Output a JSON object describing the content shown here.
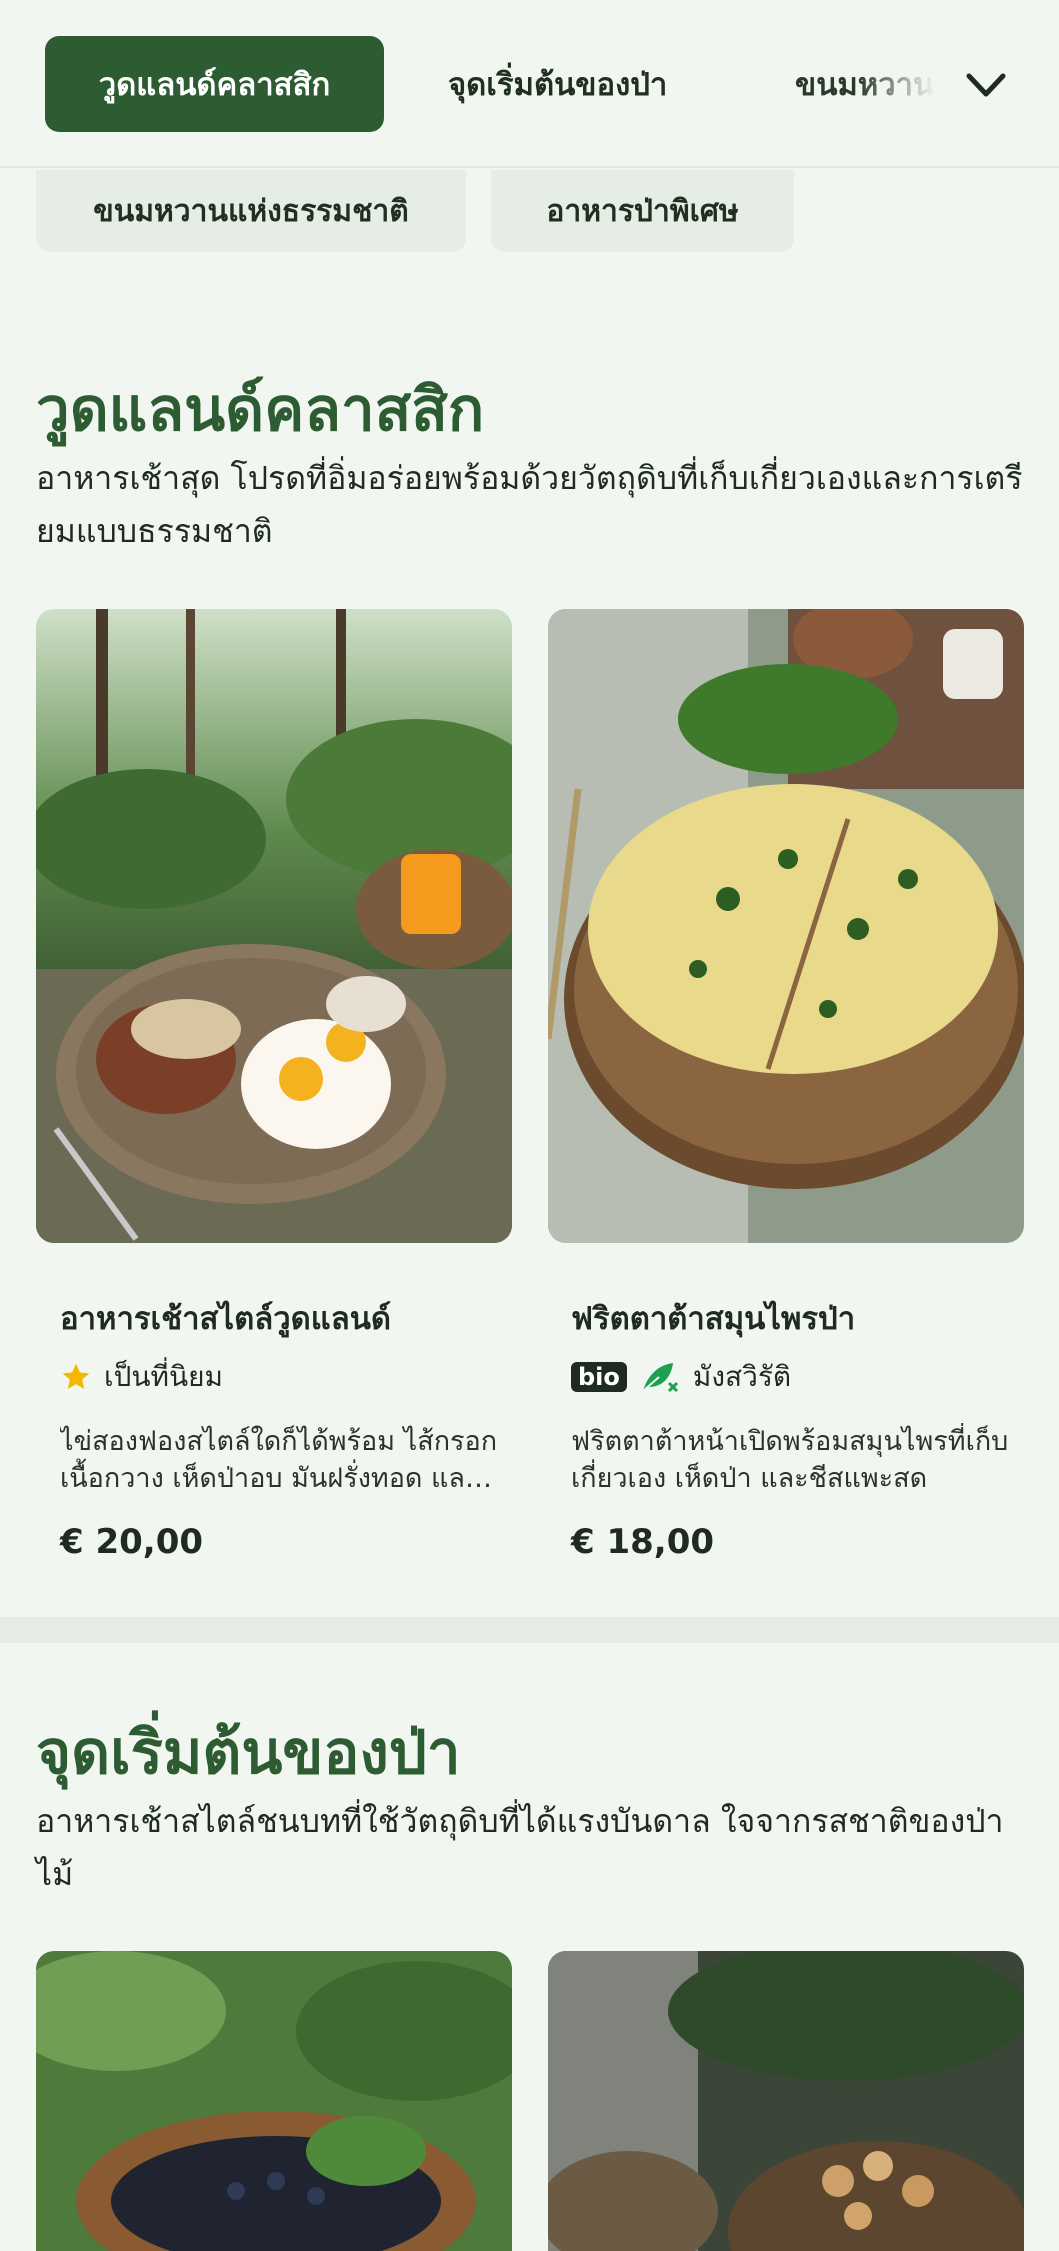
{
  "nav": {
    "tabs": [
      {
        "label": "วูดแลนด์คลาสสิก",
        "active": true
      },
      {
        "label": "จุดเริ่มต้นของป่า",
        "active": false
      },
      {
        "label": "ขนมหวานแห่งธรรมชาติ",
        "active": false
      }
    ],
    "more_icon": "chevron-down-icon"
  },
  "chips": [
    "ขนมหวานแห่งธรรมชาติ",
    "อาหารป่าพิเศษ"
  ],
  "sections": [
    {
      "title": "วูดแลนด์คลาสสิก",
      "description": "อาหารเช้าสุด โปรดที่อิ่มอร่อยพร้อมด้วยวัตถุดิบที่เก็บเกี่ยวเองและการเตรียมแบบธรรมชาติ",
      "items": [
        {
          "name": "อาหารเช้าสไตล์วูดแลนด์",
          "tag": "เป็นที่นิยม",
          "tag_icon": "star-icon",
          "description": "ไข่สองฟองสไตล์ใดก็ได้พร้อม ไส้กรอกเนื้อกวาง เห็ดป่าอบ มันฝรั่งทอด และขนมปังซาวร์โดว์",
          "price": "€ 20,00"
        },
        {
          "name": "ฟริตตาต้าสมุนไพรป่า",
          "badge": "bio",
          "tag": "มังสวิรัติ",
          "tag_icon": "leaf-icon",
          "description": "ฟริตตาต้าหน้าเปิดพร้อมสมุนไพรที่เก็บเกี่ยวเอง เห็ดป่า และชีสแพะสด",
          "price": "€ 18,00"
        }
      ]
    },
    {
      "title": "จุดเริ่มต้นของป่า",
      "description": "อาหารเช้าสไตล์ชนบทที่ใช้วัตถุดิบที่ได้แรงบันดาล ใจจากรสชาติของป่าไม้"
    }
  ],
  "colors": {
    "accent": "#2d5c33",
    "background": "#f1f6f1",
    "star": "#f5b800",
    "leaf": "#1fa050"
  }
}
